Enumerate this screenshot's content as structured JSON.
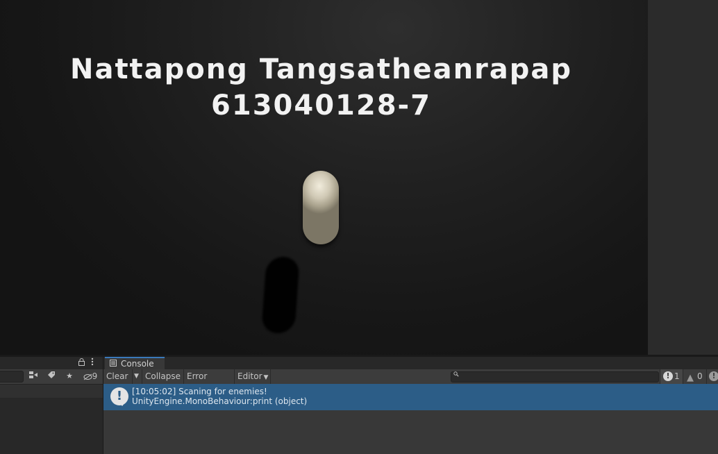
{
  "game": {
    "overlay_name": "Nattapong Tangsatheanrapap",
    "overlay_id": "613040128-7"
  },
  "hierarchy": {
    "filter_count": "9",
    "icons": [
      "lock-icon",
      "kebab-icon",
      "scene-visibility-icon",
      "tag-icon",
      "star-icon",
      "hidden-eye-icon"
    ]
  },
  "console": {
    "tab_label": "Console",
    "toolbar": {
      "clear_label": "Clear",
      "collapse_label": "Collapse",
      "error_pause_label": "Error Pause",
      "editor_label": "Editor"
    },
    "counts": {
      "log": "1",
      "warning": "0"
    },
    "entries": [
      {
        "line1": "[10:05:02] Scaning for enemies!",
        "line2": "UnityEngine.MonoBehaviour:print (object)"
      }
    ],
    "colors": {
      "selected_row": "#2c5d87",
      "tab_accent": "#3a79bb"
    }
  }
}
